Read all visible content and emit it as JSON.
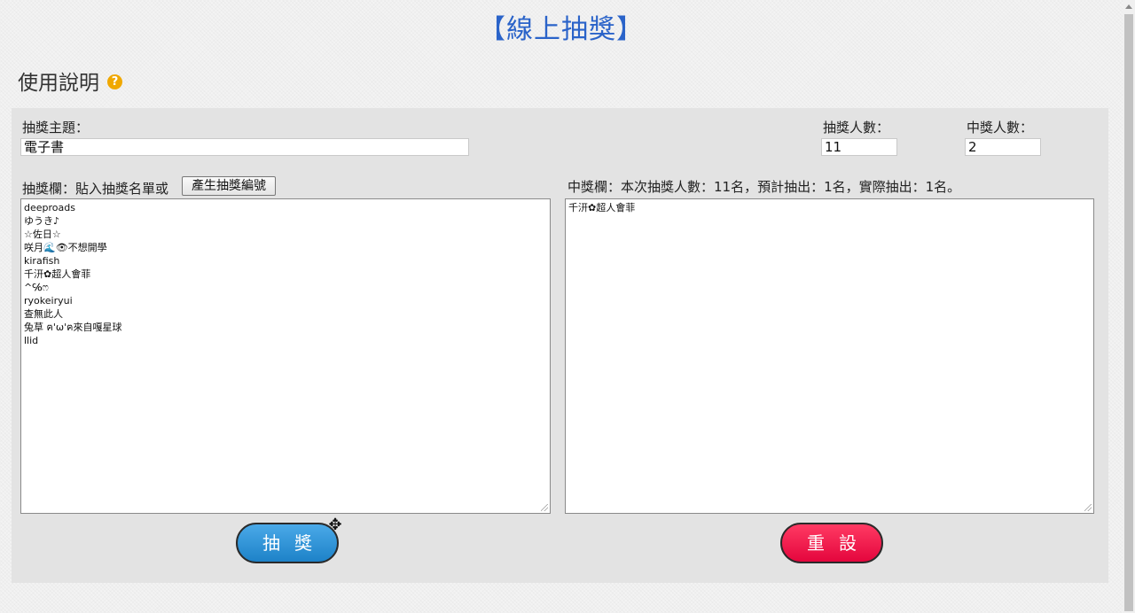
{
  "page": {
    "title": "【線上抽獎】"
  },
  "help": {
    "heading": "使用說明",
    "icon": "question-icon",
    "icon_glyph": "?"
  },
  "form": {
    "topic_label": "抽獎主題：",
    "topic_value": "電子書",
    "entrants_label": "抽獎人數：",
    "entrants_value": "11",
    "winners_label": "中獎人數：",
    "winners_value": "2"
  },
  "entries": {
    "label": "抽獎欄：貼入抽獎名單或",
    "generate_button": "產生抽獎編號",
    "lines": [
      "deeproads",
      "ゆうき♪",
      "☆佐日☆",
      "咲月🌊👁不想開學",
      "kirafish",
      "千汧✿超人會菲",
      "^℅ෆ",
      "ryokeiryui",
      "查無此人",
      "兔草 ฅ'ω'ฅ來自嘎星球",
      "llid"
    ]
  },
  "winners": {
    "label": "中獎欄：本次抽獎人數：11名，預計抽出：1名，實際抽出：1名。",
    "lines": [
      "千汧✿超人會菲"
    ]
  },
  "buttons": {
    "draw": "抽獎",
    "reset": "重設"
  },
  "cursor": {
    "icon": "move-cursor-icon",
    "glyph": "✥"
  },
  "colors": {
    "title": "#2a63c9",
    "draw_button": "#1d82c8",
    "reset_button": "#e4063d",
    "help_icon": "#f0a800"
  }
}
